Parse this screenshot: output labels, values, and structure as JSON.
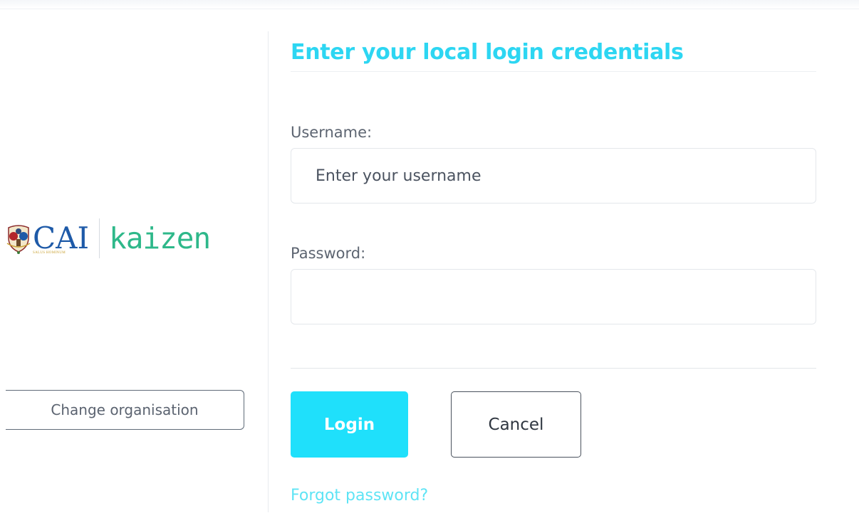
{
  "colors": {
    "accent": "#1fe0fb",
    "title": "#2dd6f2",
    "link": "#5ee4f5",
    "cai_blue": "#1e5aa8",
    "kaizen_green": "#2eb88a"
  },
  "branding": {
    "crest_icon": "cai-crest-icon",
    "cai_logo_text": "CAI",
    "cai_motto": "SALUS HOMINUM",
    "kaizen_logo_text": "kaizen"
  },
  "sidebar": {
    "change_org_label": "Change organisation"
  },
  "login_form": {
    "title": "Enter your local login credentials",
    "username": {
      "label": "Username:",
      "placeholder": "Enter your username",
      "value": ""
    },
    "password": {
      "label": "Password:",
      "placeholder": "",
      "value": ""
    },
    "login_label": "Login",
    "cancel_label": "Cancel",
    "forgot_label": "Forgot password?"
  }
}
